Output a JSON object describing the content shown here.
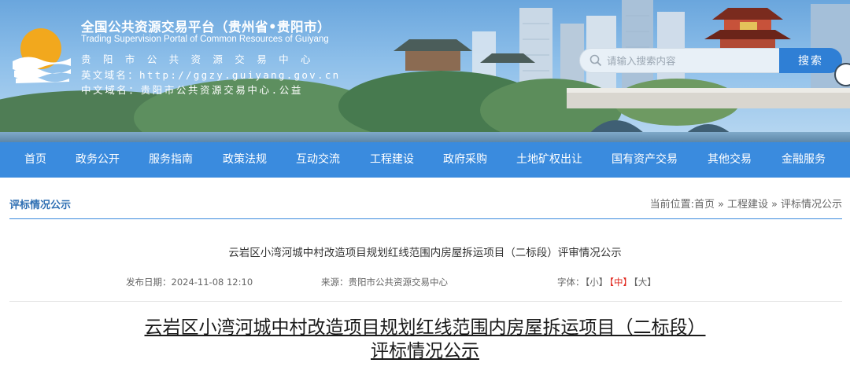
{
  "header": {
    "title_cn": "全国公共资源交易平台（贵州省•贵阳市）",
    "title_en": "Trading Supervision Portal of Common Resources of Guiyang",
    "org_name": "贵阳市公共资源交易中心",
    "domain_en_label": "英文域名：",
    "domain_en_value": "http://ggzy.guiyang.gov.cn",
    "domain_cn_label": "中文域名：",
    "domain_cn_value": "贵阳市公共资源交易中心.公益",
    "logo_icon": "sun-over-waves-logo-icon",
    "colors": {
      "banner_sky": "#8fc0ea",
      "logo_orange": "#f2a81d"
    }
  },
  "search": {
    "placeholder": "请输入搜索内容",
    "button_label": "搜索"
  },
  "nav": {
    "items": [
      {
        "label": "首页"
      },
      {
        "label": "政务公开"
      },
      {
        "label": "服务指南"
      },
      {
        "label": "政策法规"
      },
      {
        "label": "互动交流"
      },
      {
        "label": "工程建设"
      },
      {
        "label": "政府采购"
      },
      {
        "label": "土地矿权出让"
      },
      {
        "label": "国有资产交易"
      },
      {
        "label": "其他交易"
      },
      {
        "label": "金融服务"
      }
    ],
    "color": "#3a8bde"
  },
  "section": {
    "title": "评标情况公示"
  },
  "breadcrumb": {
    "prefix": "当前位置:",
    "items": [
      "首页",
      "工程建设",
      "评标情况公示"
    ],
    "separator": "»"
  },
  "article": {
    "title": "云岩区小湾河城中村改造项目规划红线范围内房屋拆运项目（二标段）评审情况公示",
    "date_label": "发布日期：",
    "date_value": "2024-11-08 12:10",
    "source_label": "来源：",
    "source_value": "贵阳市公共资源交易中心",
    "font_label": "字体：",
    "font_small": "【小】",
    "font_medium": "【中】",
    "font_large": "【大】",
    "font_active": "medium",
    "active_color": "#e0261c",
    "heading_line1": "云岩区小湾河城中村改造项目规划红线范围内房屋拆运项目（二标段）",
    "heading_line2": "评标情况公示"
  }
}
